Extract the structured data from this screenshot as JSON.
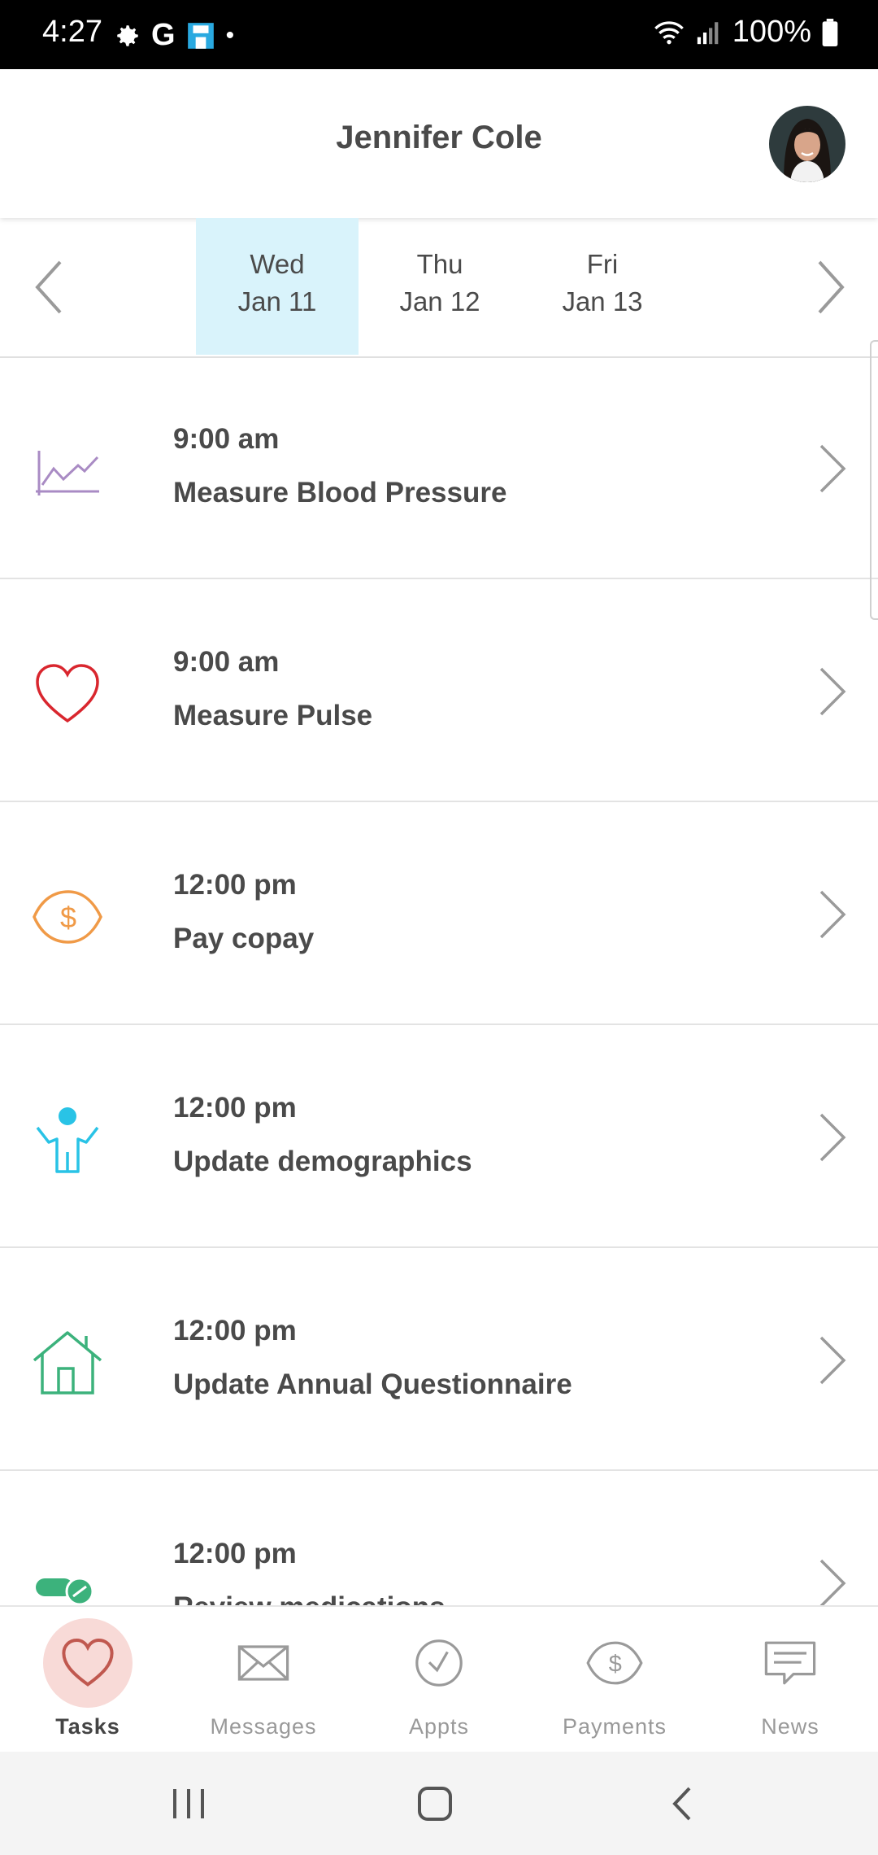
{
  "status_bar": {
    "time": "4:27",
    "battery": "100%"
  },
  "header": {
    "title": "Jennifer Cole"
  },
  "dates": [
    {
      "weekday": "Wed",
      "date": "Jan 11",
      "selected": true
    },
    {
      "weekday": "Thu",
      "date": "Jan 12",
      "selected": false
    },
    {
      "weekday": "Fri",
      "date": "Jan 13",
      "selected": false
    }
  ],
  "tasks": [
    {
      "time": "9:00 am",
      "name": "Measure Blood Pressure",
      "icon": "chart-line-icon",
      "color": "#a98bc4"
    },
    {
      "time": "9:00 am",
      "name": "Measure Pulse",
      "icon": "heart-icon",
      "color": "#d9262e"
    },
    {
      "time": "12:00 pm",
      "name": "Pay copay",
      "icon": "dollar-tag-icon",
      "color": "#f09a47"
    },
    {
      "time": "12:00 pm",
      "name": "Update demographics",
      "icon": "person-icon",
      "color": "#29c3e6"
    },
    {
      "time": "12:00 pm",
      "name": "Update Annual Questionnaire",
      "icon": "house-icon",
      "color": "#3cb27c"
    },
    {
      "time": "12:00 pm",
      "name": "Review medications",
      "icon": "pills-icon",
      "color": "#3cb27c"
    }
  ],
  "tabs": [
    {
      "label": "Tasks",
      "icon": "heart-icon",
      "active": true
    },
    {
      "label": "Messages",
      "icon": "envelope-icon",
      "active": false
    },
    {
      "label": "Appts",
      "icon": "clock-icon",
      "active": false
    },
    {
      "label": "Payments",
      "icon": "dollar-tag-icon",
      "active": false
    },
    {
      "label": "News",
      "icon": "chat-icon",
      "active": false
    }
  ]
}
